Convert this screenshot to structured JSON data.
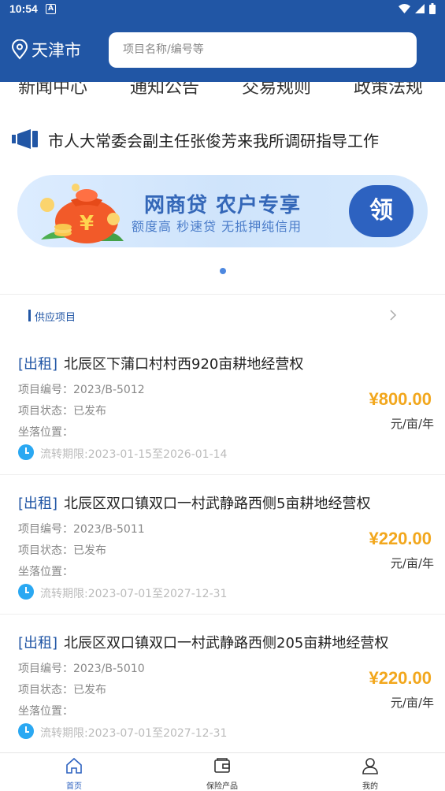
{
  "status_bar": {
    "time": "10:54",
    "a_badge": "A"
  },
  "header": {
    "city": "天津市",
    "search_placeholder": "项目名称/编号等"
  },
  "categories": [
    "新闻中心",
    "通知公告",
    "交易规则",
    "政策法规"
  ],
  "notice": {
    "text": "市人大常委会副主任张俊芳来我所调研指导工作"
  },
  "banner": {
    "title": "网商贷 农户专享",
    "subtitle": "额度高 秒速贷 无抵押纯信用",
    "button": "领",
    "coin_symbol": "¥"
  },
  "section": {
    "title": "供应项目"
  },
  "items": [
    {
      "tag": "[出租]",
      "name": "北辰区下蒲口村村西920亩耕地经营权",
      "code_label": "项目编号：",
      "code": "2023/B-5012",
      "status_label": "项目状态：",
      "status": "已发布",
      "location_label": "坐落位置：",
      "period": "流转期限:2023-01-15至2026-01-14",
      "price": "¥800.00",
      "unit": "元/亩/年"
    },
    {
      "tag": "[出租]",
      "name": "北辰区双口镇双口一村武静路西侧5亩耕地经营权",
      "code_label": "项目编号：",
      "code": "2023/B-5011",
      "status_label": "项目状态：",
      "status": "已发布",
      "location_label": "坐落位置：",
      "period": "流转期限:2023-07-01至2027-12-31",
      "price": "¥220.00",
      "unit": "元/亩/年"
    },
    {
      "tag": "[出租]",
      "name": "北辰区双口镇双口一村武静路西侧205亩耕地经营权",
      "code_label": "项目编号：",
      "code": "2023/B-5010",
      "status_label": "项目状态：",
      "status": "已发布",
      "location_label": "坐落位置：",
      "period": "流转期限:2023-07-01至2027-12-31",
      "price": "¥220.00",
      "unit": "元/亩/年"
    }
  ],
  "tabbar": [
    {
      "label": "首页",
      "icon": "home-icon",
      "active": true
    },
    {
      "label": "保险产品",
      "icon": "wallet-icon",
      "active": false
    },
    {
      "label": "我的",
      "icon": "user-icon",
      "active": false
    }
  ],
  "colors": {
    "brand": "#2156a5",
    "price": "#f2a71d",
    "active_tab": "#2d62c0"
  }
}
